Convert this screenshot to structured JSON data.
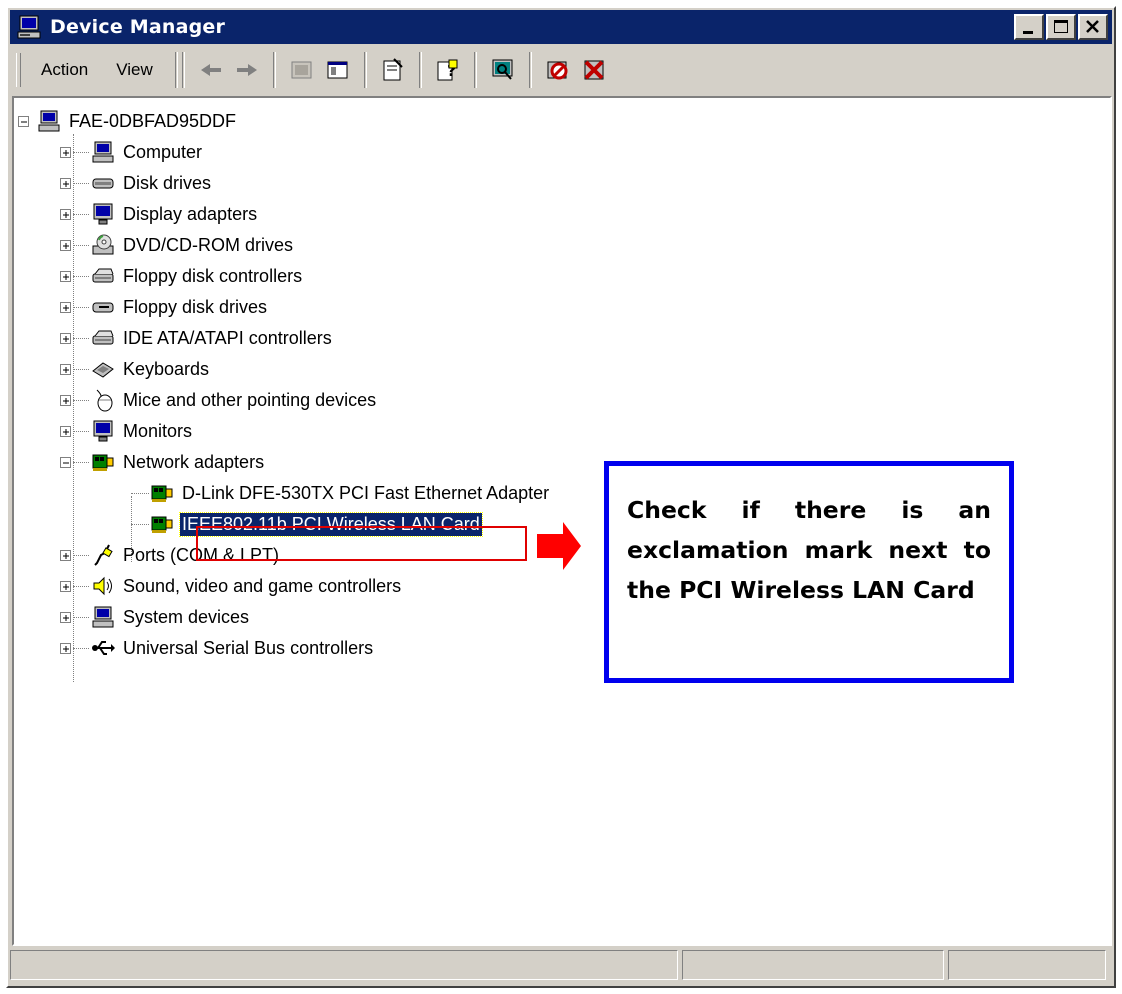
{
  "window": {
    "title": "Device Manager",
    "title_icon": "computer-icon",
    "controls": [
      "minimize-icon",
      "maximize-icon",
      "close-icon"
    ]
  },
  "toolbar": {
    "menu": [
      {
        "label": "Action"
      },
      {
        "label": "View"
      }
    ],
    "buttons": [
      "back-arrow-icon",
      "forward-arrow-icon",
      "up-folder-icon",
      "show-hide-tree-icon",
      "properties-icon",
      "help-icon",
      "scan-hardware-icon",
      "disable-device-icon",
      "uninstall-device-icon"
    ]
  },
  "tree": {
    "root": {
      "label": "FAE-0DBFAD95DDF",
      "icon": "computer-icon",
      "expanded": true
    },
    "categories": [
      {
        "label": "Computer",
        "icon": "computer-icon",
        "expanded": false
      },
      {
        "label": "Disk drives",
        "icon": "disk-drive-icon",
        "expanded": false
      },
      {
        "label": "Display adapters",
        "icon": "display-adapter-icon",
        "expanded": false
      },
      {
        "label": "DVD/CD-ROM drives",
        "icon": "cdrom-icon",
        "expanded": false
      },
      {
        "label": "Floppy disk controllers",
        "icon": "controller-icon",
        "expanded": false
      },
      {
        "label": "Floppy disk drives",
        "icon": "floppy-drive-icon",
        "expanded": false
      },
      {
        "label": "IDE ATA/ATAPI controllers",
        "icon": "controller-icon",
        "expanded": false
      },
      {
        "label": "Keyboards",
        "icon": "keyboard-icon",
        "expanded": false
      },
      {
        "label": "Mice and other pointing devices",
        "icon": "mouse-icon",
        "expanded": false
      },
      {
        "label": "Monitors",
        "icon": "monitor-icon",
        "expanded": false
      },
      {
        "label": "Network adapters",
        "icon": "network-card-icon",
        "expanded": true,
        "children": [
          {
            "label": "D-Link DFE-530TX PCI Fast Ethernet Adapter",
            "icon": "network-card-icon"
          },
          {
            "label": "IEEE802.11b PCI Wireless LAN Card",
            "icon": "network-card-icon",
            "selected": true
          }
        ]
      },
      {
        "label": "Ports (COM & LPT)",
        "icon": "port-icon",
        "expanded": false
      },
      {
        "label": "Sound, video and game controllers",
        "icon": "speaker-icon",
        "expanded": false
      },
      {
        "label": "System devices",
        "icon": "computer-icon",
        "expanded": false
      },
      {
        "label": "Universal Serial Bus controllers",
        "icon": "usb-icon",
        "expanded": false
      }
    ]
  },
  "annotation": {
    "text": "Check if there is an exclamation mark next to the PCI Wireless LAN Card",
    "box_color": "#0000ee",
    "highlight_color": "#e00000",
    "arrow_color": "#ff0000"
  },
  "statusbar": {
    "panels": [
      "",
      "",
      ""
    ]
  }
}
